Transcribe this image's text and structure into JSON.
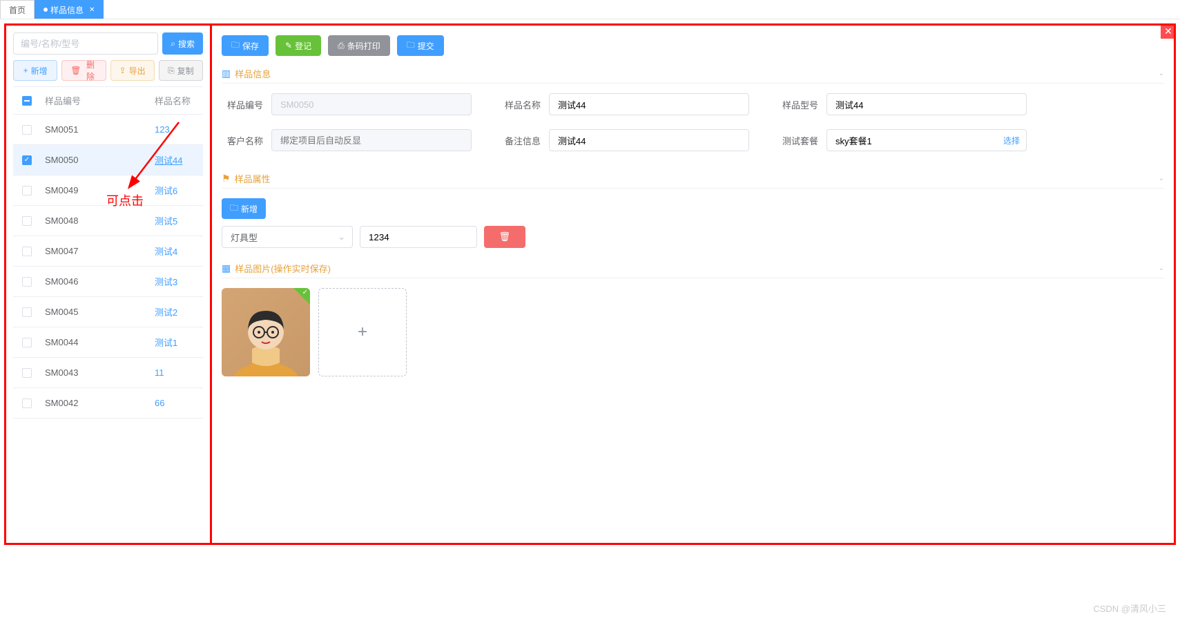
{
  "tabs": {
    "home": "首页",
    "active": "样品信息"
  },
  "search": {
    "placeholder": "编号/名称/型号",
    "button": "搜索"
  },
  "toolbar": {
    "add": "新增",
    "delete": "删除",
    "export": "导出",
    "copy": "复制"
  },
  "table": {
    "headers": {
      "id": "样品编号",
      "name": "样品名称"
    },
    "rows": [
      {
        "id": "SM0051",
        "name": "123",
        "checked": false
      },
      {
        "id": "SM0050",
        "name": "测试44",
        "checked": true
      },
      {
        "id": "SM0049",
        "name": "测试6",
        "checked": false
      },
      {
        "id": "SM0048",
        "name": "测试5",
        "checked": false
      },
      {
        "id": "SM0047",
        "name": "测试4",
        "checked": false
      },
      {
        "id": "SM0046",
        "name": "测试3",
        "checked": false
      },
      {
        "id": "SM0045",
        "name": "测试2",
        "checked": false
      },
      {
        "id": "SM0044",
        "name": "测试1",
        "checked": false
      },
      {
        "id": "SM0043",
        "name": "11",
        "checked": false
      },
      {
        "id": "SM0042",
        "name": "66",
        "checked": false
      }
    ]
  },
  "annotation": "可点击",
  "detail": {
    "buttons": {
      "save": "保存",
      "register": "登记",
      "barcode": "条码打印",
      "submit": "提交"
    },
    "section_info": "样品信息",
    "section_attr": "样品属性",
    "section_img": "样品图片(操作实时保存)",
    "add_attr": "新增",
    "fields": {
      "sample_no_label": "样品编号",
      "sample_no_value": "SM0050",
      "sample_name_label": "样品名称",
      "sample_name_value": "测试44",
      "sample_model_label": "样品型号",
      "sample_model_value": "测试44",
      "customer_label": "客户名称",
      "customer_placeholder": "绑定项目后自动反显",
      "remark_label": "备注信息",
      "remark_value": "测试44",
      "package_label": "测试套餐",
      "package_value": "sky套餐1",
      "package_action": "选择"
    },
    "attr": {
      "type": "灯具型",
      "value": "1234"
    }
  },
  "watermark": "CSDN @清风小三"
}
